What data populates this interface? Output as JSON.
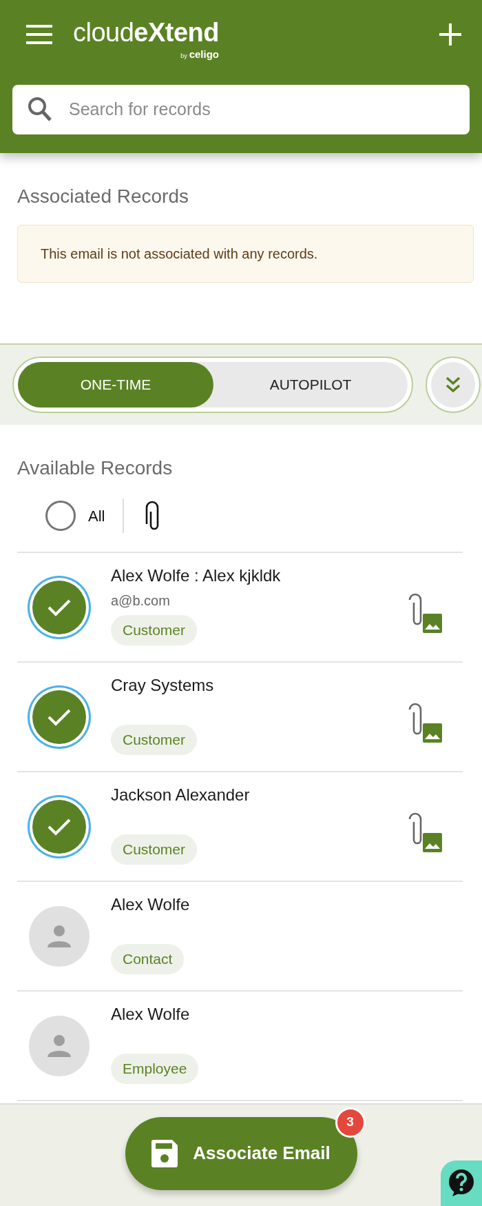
{
  "header": {
    "logo": "cloud**eXtend**",
    "byline_prefix": "by",
    "byline": "celigo"
  },
  "search": {
    "placeholder": "Search for records"
  },
  "associated": {
    "title": "Associated Records",
    "alert": "This email is not associated with any records."
  },
  "modes": [
    {
      "label": "ONE-TIME",
      "selected": true
    },
    {
      "label": "AUTOPILOT",
      "selected": false
    }
  ],
  "available": {
    "title": "Available Records",
    "select_all": {
      "label": "All",
      "checked": false
    }
  },
  "records": [
    {
      "name": "Alex Wolfe : Alex kjkldk",
      "email": "a@b.com",
      "tag": "Customer",
      "selected": true,
      "attachment": true
    },
    {
      "name": "Cray Systems",
      "tag": "Customer",
      "selected": true,
      "attachment": true
    },
    {
      "name": "Jackson Alexander",
      "tag": "Customer",
      "selected": true,
      "attachment": true
    },
    {
      "name": "Alex Wolfe",
      "tag": "Contact",
      "selected": false,
      "attachment": false
    },
    {
      "name": "Alex Wolfe",
      "tag": "Employee",
      "selected": false,
      "attachment": false
    }
  ],
  "action": {
    "label": "Associate Email",
    "count": "3"
  }
}
